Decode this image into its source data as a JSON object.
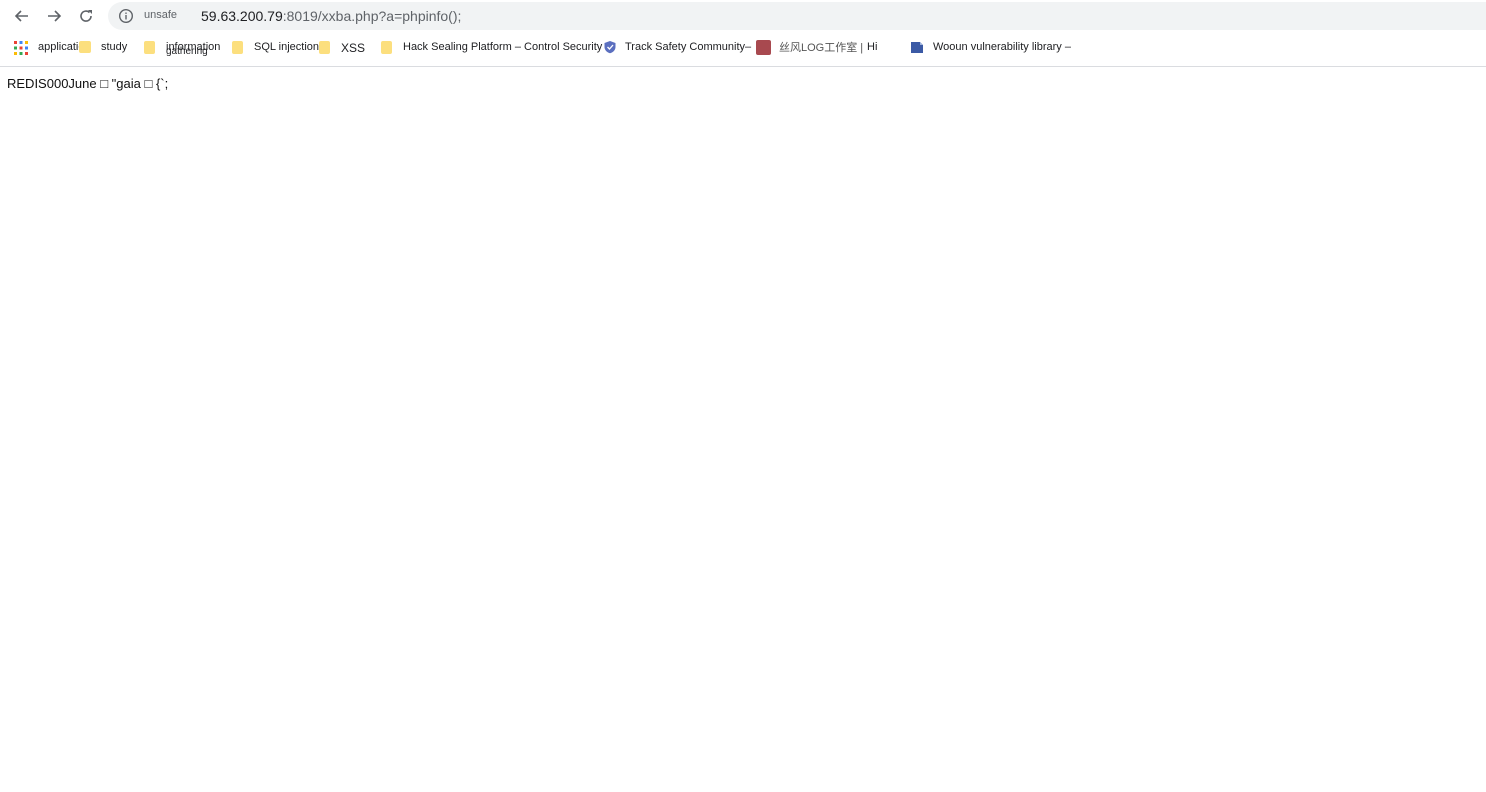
{
  "toolbar": {
    "back_label": "←",
    "forward_label": "→",
    "security_chip": "unsafe",
    "url_host": "59.63.200.79",
    "url_rest": ":8019/xxba.php?a=phpinfo();"
  },
  "bookmarks": {
    "items": [
      {
        "label": "application"
      },
      {
        "label": "study"
      },
      {
        "label": "information",
        "sub": "gathering"
      },
      {
        "label": "SQL injection"
      },
      {
        "label": "XSS"
      },
      {
        "label": "Hack Sealing Platform – Control Security"
      },
      {
        "label": "Track Safety Community–"
      },
      {
        "label": "丝风LOG工作室 |"
      },
      {
        "label": "Hi"
      },
      {
        "label": "Wooun vulnerability library –"
      }
    ]
  },
  "page": {
    "content": "REDIS000June □ \"gaia □ {`;"
  },
  "colors": {
    "folder": "#fcdf7e",
    "omnibox_bg": "#f1f3f4",
    "border": "#dadce0"
  }
}
